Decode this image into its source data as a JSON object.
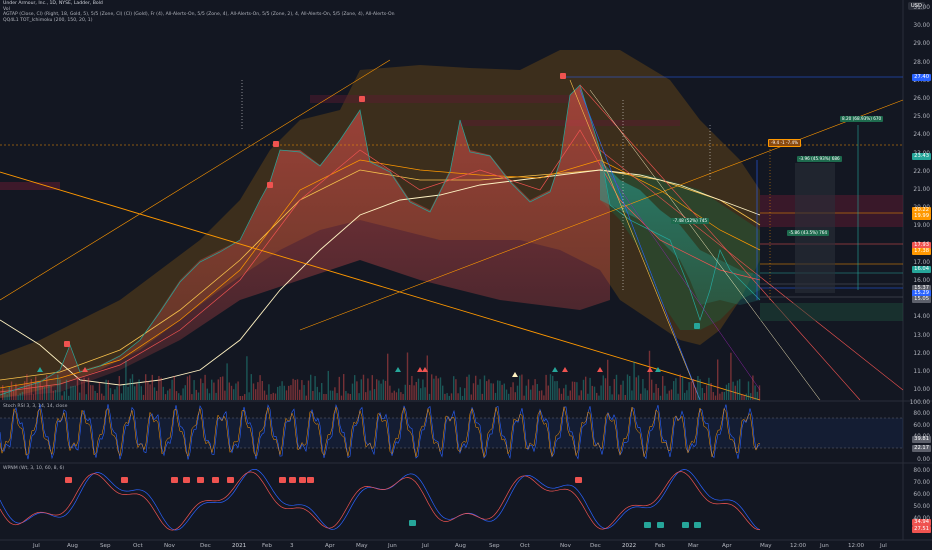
{
  "legend": {
    "title": "Under Armour, Inc., 1D, NYSE, Ladder, Bold",
    "vol": "Vol",
    "line3": "AGTAP (Close, Cl) (Right, 18, Gold, 5), 5/5 (Zone, Cl) (Cl) (Gold), Fr (4), All-Alerts-On, 5/5 (Zone, 4), All-Alerts-On, 5/5 (Zone, 2), 4, All-Alerts-On, 5/5 (Zone, 4), All-Alerts-On",
    "line4": "QQ4L1 TOT_Ichimoku (200, 150, 20, 1)"
  },
  "currency_button": "USD",
  "price_axis": [
    "31.00",
    "30.00",
    "29.00",
    "28.00",
    "27.00",
    "26.00",
    "25.00",
    "24.00",
    "23.00",
    "22.00",
    "21.00",
    "20.00",
    "19.00",
    "18.00",
    "17.00",
    "16.00",
    "15.00",
    "14.00",
    "13.00",
    "12.00",
    "11.00",
    "10.00"
  ],
  "price_tags": [
    {
      "text": "27.40",
      "color": "#2962ff"
    },
    {
      "text": "23.43",
      "color": "#26a69a"
    },
    {
      "text": "20.22",
      "color": "#ff9800"
    },
    {
      "text": "19.99",
      "color": "#ff9800"
    },
    {
      "text": "17.93",
      "color": "#ef5350"
    },
    {
      "text": "17.38",
      "color": "#ff9800"
    },
    {
      "text": "16.04",
      "color": "#26a69a"
    },
    {
      "text": "15.37",
      "color": "#5d606b"
    },
    {
      "text": "15.29",
      "color": "#2962ff"
    },
    {
      "text": "15.05",
      "color": "#5d606b"
    }
  ],
  "rsi_axis": [
    "100.00",
    "80.00",
    "60.00",
    "40.00",
    "20.00",
    "0.00"
  ],
  "rsi_tags": [
    {
      "text": "39.81",
      "color": "#5d606b"
    },
    {
      "text": "22.17",
      "color": "#5d606b"
    }
  ],
  "stoch_axis": [
    "80.00",
    "70.00",
    "60.00",
    "50.00",
    "40.00",
    "30.00"
  ],
  "stoch_tags": [
    {
      "text": "34.94",
      "color": "#ef5350"
    },
    {
      "text": "27.51",
      "color": "#ef5350"
    }
  ],
  "indicator_labels": {
    "rsi": "Stoch RSI 3, 3, 14, 14, close",
    "stoch": "WPNM (Wt, 3, 10, 60, 8, 6)"
  },
  "time_axis": [
    "Jul",
    "Aug",
    "Sep",
    "Oct",
    "Nov",
    "Dec",
    "2021",
    "Feb",
    "3",
    "Apr",
    "May",
    "Jun",
    "Jul",
    "Aug",
    "Sep",
    "Oct",
    "Nov",
    "Dec",
    "2022",
    "Feb",
    "Mar",
    "Apr",
    "May",
    "12:00",
    "Jun",
    "12:00",
    "Jul"
  ],
  "annotations": [
    {
      "text": "8.20 (68.93%) 670"
    },
    {
      "text": "-3.96 (45.93%) 686"
    },
    {
      "text": "-7.48 (52%) 745"
    },
    {
      "text": "-5.86 (43.5%) 764"
    },
    {
      "text": "-9.4 -1  -7.4%"
    }
  ],
  "colors": {
    "bg": "#131722",
    "up": "#26a69a",
    "down": "#ef5350",
    "gold": "#f7c04b",
    "orange": "#ff9800",
    "blue": "#2962ff",
    "cream": "#fff2c2"
  }
}
